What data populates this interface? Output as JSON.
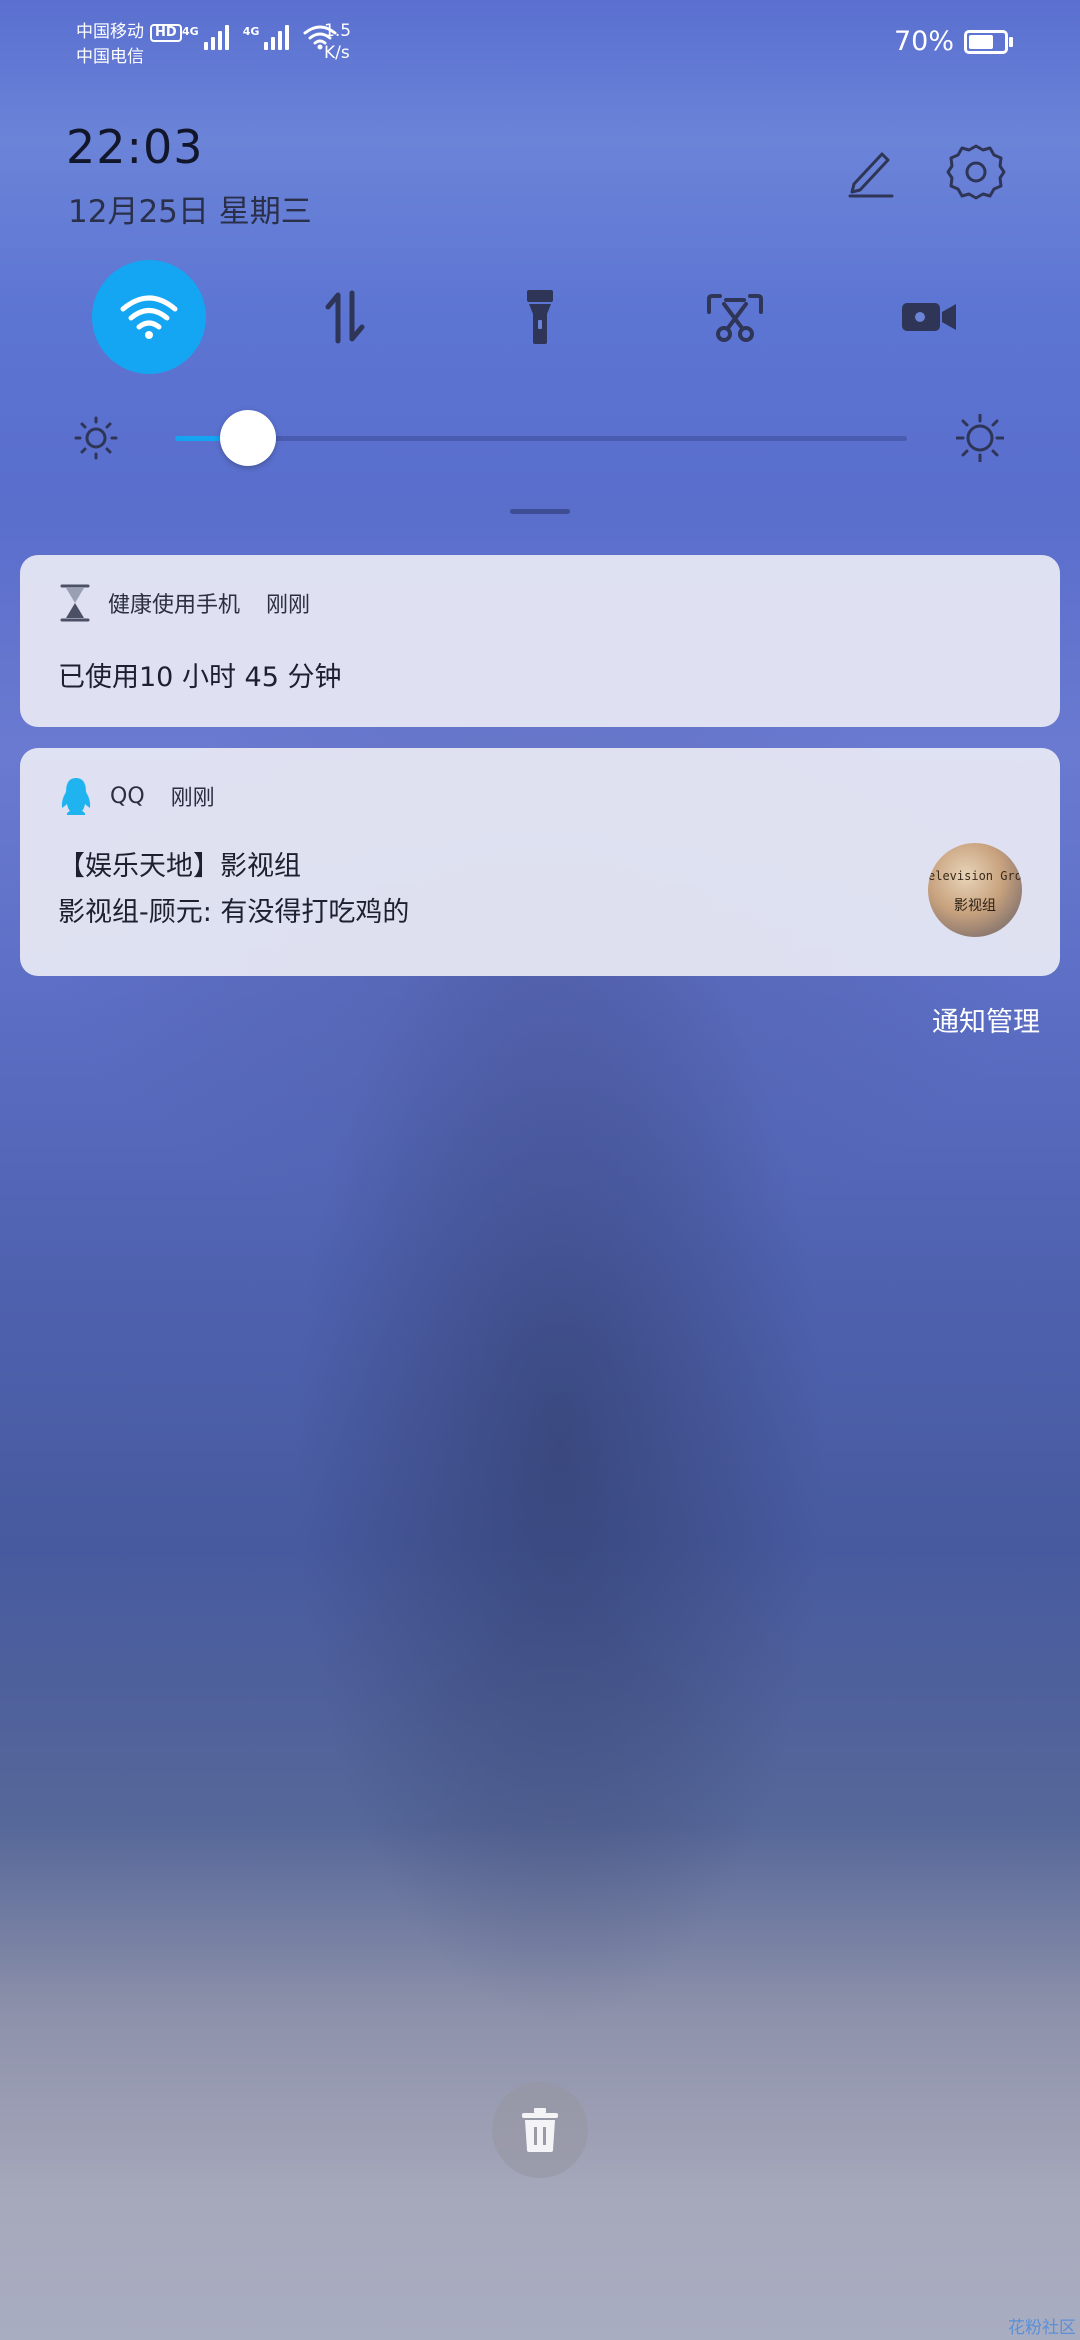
{
  "status_bar": {
    "carrier_1": "中国移动",
    "carrier_1_badge": "HD",
    "carrier_2": "中国电信",
    "signal_tag_1": "4G",
    "signal_tag_2": "4G",
    "speed_value": "1.5",
    "speed_unit": "K/s",
    "battery_percent": "70%",
    "battery_level": 0.7
  },
  "header": {
    "time": "22:03",
    "date": "12月25日 星期三",
    "edit_icon": "pencil-icon",
    "settings_icon": "gear-icon"
  },
  "quick_toggles": [
    {
      "name": "wifi",
      "icon": "wifi-icon",
      "active": true
    },
    {
      "name": "mobile-data",
      "icon": "data-arrows-icon",
      "active": false
    },
    {
      "name": "flashlight",
      "icon": "flashlight-icon",
      "active": false
    },
    {
      "name": "screenshot",
      "icon": "scissors-icon",
      "active": false
    },
    {
      "name": "screen-record",
      "icon": "video-camera-icon",
      "active": false
    }
  ],
  "brightness": {
    "level": 0.1
  },
  "notifications": [
    {
      "app_name": "健康使用手机",
      "time": "刚刚",
      "icon": "hourglass-icon",
      "line1": "已使用10 小时 45 分钟"
    },
    {
      "app_name": "QQ",
      "time": "刚刚",
      "icon": "qq-penguin-icon",
      "line1": "【娱乐天地】影视组",
      "line2": "影视组-顾元: 有没得打吃鸡的",
      "thumb_text_1": "elevision Grou",
      "thumb_text_2": "影视组"
    }
  ],
  "footer": {
    "notification_management": "通知管理",
    "clear_icon": "trash-icon",
    "watermark": "花粉社区"
  },
  "colors": {
    "accent": "#14a6f2",
    "icon_dark": "#2f3557"
  }
}
